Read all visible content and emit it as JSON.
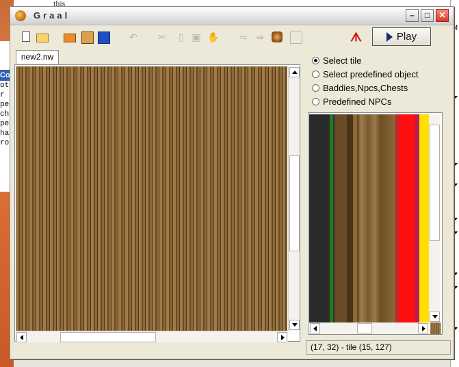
{
  "window": {
    "title": "Graal",
    "buttons": {
      "minimize": "–",
      "maximize": "□",
      "close": "✕"
    }
  },
  "background": {
    "top_text": "this",
    "left_header": "Cor",
    "left_lines": [
      "ot r",
      "pe",
      "ch",
      "pe",
      "ha",
      "rog"
    ],
    "right_letter": "M"
  },
  "toolbar": {
    "icons": [
      "new-file-icon",
      "open-icon",
      "open-folder-icon",
      "save-icon",
      "save-as-icon",
      "undo-icon",
      "cut-icon",
      "copy-icon",
      "paste-icon",
      "drag-icon",
      "forward-icon",
      "forward2-icon",
      "npc-icon",
      "grid-icon",
      "link-icon"
    ],
    "play_label": "Play"
  },
  "tab": {
    "label": "new2.nw"
  },
  "selection": {
    "options": [
      {
        "label": "Select tile",
        "checked": true
      },
      {
        "label": "Select predefined object",
        "checked": false
      },
      {
        "label": "Baddies,Npcs,Chests",
        "checked": false
      },
      {
        "label": "Predefined NPCs",
        "checked": false
      }
    ]
  },
  "status": {
    "text": "(17, 32) - tile (15, 127)"
  }
}
